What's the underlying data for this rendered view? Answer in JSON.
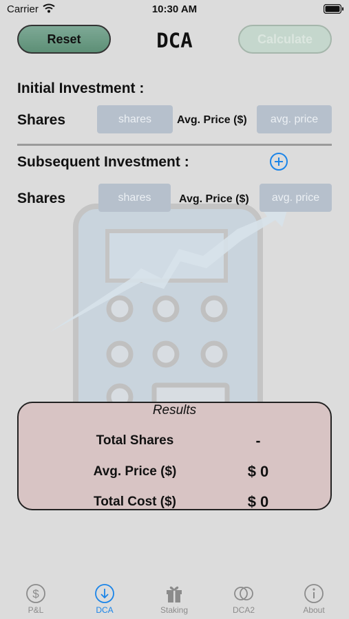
{
  "status_bar": {
    "carrier": "Carrier",
    "time": "10:30 AM"
  },
  "header": {
    "reset_label": "Reset",
    "title": "DCA",
    "calculate_label": "Calculate"
  },
  "initial": {
    "heading": "Initial Investment :",
    "shares_label": "Shares",
    "shares_placeholder": "shares",
    "avg_price_label": "Avg. Price ($)",
    "avg_price_placeholder": "avg. price"
  },
  "subsequent": {
    "heading": "Subsequent Investment :",
    "add_icon": "plus-circle-icon",
    "shares_label": "Shares",
    "shares_placeholder": "shares",
    "avg_price_label": "Avg. Price ($)",
    "avg_price_placeholder": "avg. price"
  },
  "results": {
    "title": "Results",
    "rows": [
      {
        "label": "Total Shares",
        "value": "-"
      },
      {
        "label": "Avg. Price ($)",
        "value": "$ 0"
      },
      {
        "label": "Total Cost ($)",
        "value": "$ 0"
      }
    ]
  },
  "tabs": [
    {
      "label": "P&L",
      "icon": "dollar-circle-icon",
      "active": false
    },
    {
      "label": "DCA",
      "icon": "arrow-down-circle-icon",
      "active": true
    },
    {
      "label": "Staking",
      "icon": "gift-icon",
      "active": false
    },
    {
      "label": "DCA2",
      "icon": "overlapping-circles-icon",
      "active": false
    },
    {
      "label": "About",
      "icon": "info-circle-icon",
      "active": false
    }
  ],
  "colors": {
    "accent": "#1a84e8",
    "reset_button": "#6f9f88",
    "results_bg": "#d8c4c4",
    "field_bg": "#b6c0cc",
    "tab_inactive": "#8b8b8b"
  }
}
